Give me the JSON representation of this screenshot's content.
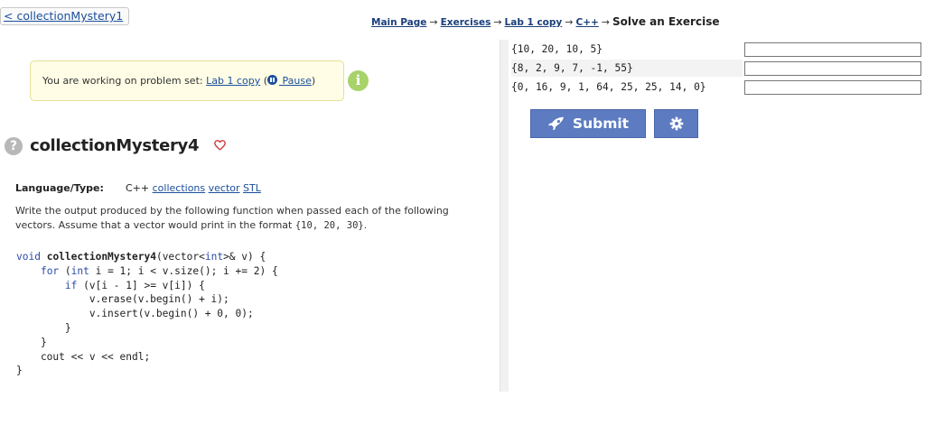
{
  "nav": {
    "back_label": "< collectionMystery1",
    "breadcrumb": [
      "Main Page",
      "Exercises",
      "Lab 1 copy",
      "C++"
    ],
    "breadcrumb_sep": "→",
    "breadcrumb_current": "Solve an Exercise"
  },
  "notice": {
    "prefix": "You are working on problem set: ",
    "set_name": "Lab 1 copy",
    "open_paren": " (",
    "pause_label": " Pause",
    "close_paren": ")",
    "info_glyph": "i"
  },
  "problem": {
    "help_glyph": "?",
    "title": "collectionMystery4",
    "language_label": "Language/Type:",
    "lang_cpp": "C++",
    "lang_tags": [
      "collections",
      "vector",
      "STL"
    ],
    "description_before": "Write the output produced by the following function when passed each of the following vectors. Assume that a vector would print in the format ",
    "format_example": "{10, 20, 30}",
    "description_after": "."
  },
  "cases": [
    {
      "input": "{10, 20, 10, 5}",
      "answer": ""
    },
    {
      "input": "{8, 2, 9, 7, -1, 55}",
      "answer": ""
    },
    {
      "input": "{0, 16, 9, 1, 64, 25, 25, 14, 0}",
      "answer": ""
    }
  ],
  "actions": {
    "submit_label": "Submit"
  },
  "colors": {
    "button": "#5d7bc0",
    "link": "#1a4f9c",
    "info": "#a8d26a",
    "heart": "#d23c3c"
  }
}
